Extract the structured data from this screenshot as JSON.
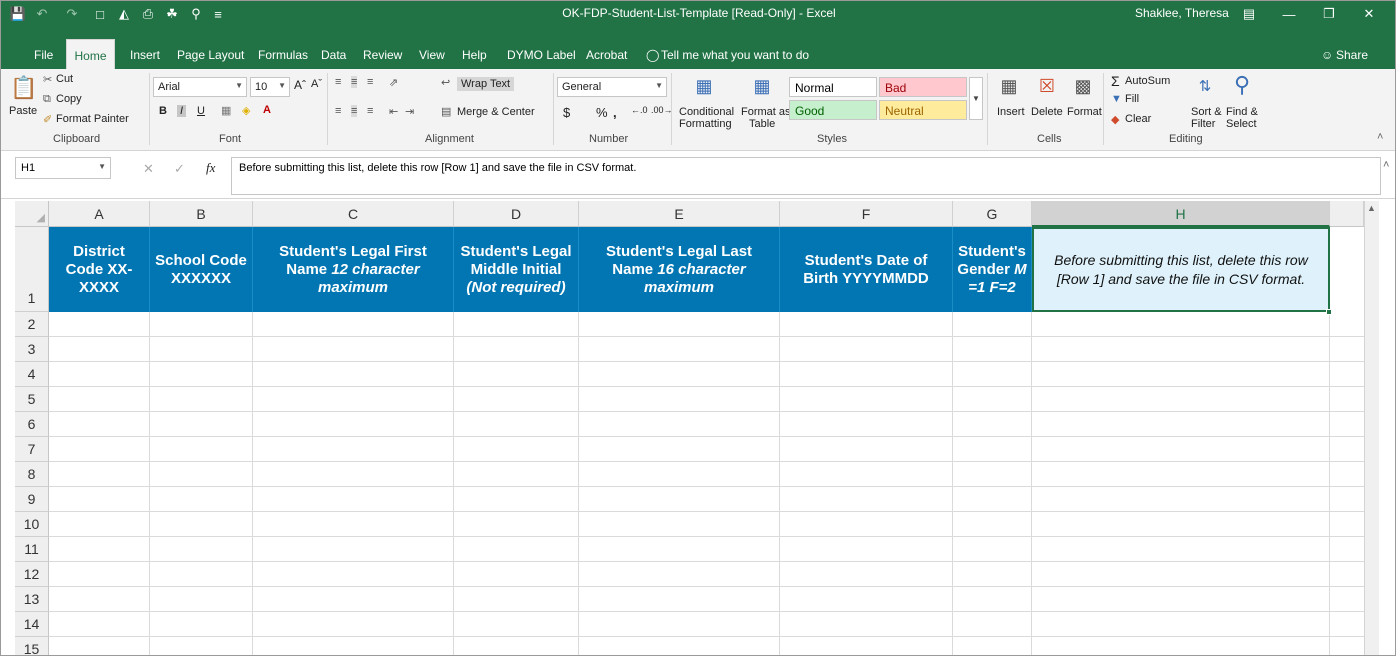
{
  "window": {
    "title": "OK-FDP-Student-List-Template  [Read-Only]  -  Excel",
    "user": "Shaklee, Theresa",
    "share_label": "Share"
  },
  "menu": {
    "tabs": [
      "File",
      "Home",
      "Insert",
      "Page Layout",
      "Formulas",
      "Data",
      "Review",
      "View",
      "Help",
      "DYMO Label",
      "Acrobat"
    ],
    "tell_me": "Tell me what you want to do"
  },
  "ribbon": {
    "clipboard": {
      "label": "Clipboard",
      "paste": "Paste",
      "cut": "Cut",
      "copy": "Copy",
      "format_painter": "Format Painter"
    },
    "font": {
      "label": "Font",
      "name": "Arial",
      "size": "10",
      "bold": "B",
      "italic": "I",
      "underline": "U"
    },
    "alignment": {
      "label": "Alignment",
      "wrap_text": "Wrap Text",
      "merge_center": "Merge & Center"
    },
    "number": {
      "label": "Number",
      "format": "General",
      "currency": "$",
      "percent": "%",
      "comma": ","
    },
    "styles": {
      "label": "Styles",
      "conditional": "Conditional",
      "formatting": "Formatting",
      "format_as": "Format as",
      "table": "Table",
      "cells": {
        "normal": "Normal",
        "bad": "Bad",
        "good": "Good",
        "neutral": "Neutral"
      },
      "colors": {
        "bad_bg": "#ffc7ce",
        "bad_fg": "#9c0006",
        "good_bg": "#c6efce",
        "good_fg": "#006100",
        "neutral_bg": "#ffeb9c",
        "neutral_fg": "#9c6500"
      }
    },
    "cells": {
      "label": "Cells",
      "insert": "Insert",
      "delete": "Delete",
      "format": "Format"
    },
    "editing": {
      "label": "Editing",
      "autosum": "AutoSum",
      "fill": "Fill",
      "clear": "Clear",
      "sort_filter": "Sort &",
      "filter": "Filter",
      "find_select": "Find &",
      "select": "Select"
    }
  },
  "formula_bar": {
    "name_box": "H1",
    "fx": "fx",
    "content": "Before submitting this list, delete this row [Row 1] and save the file in CSV format."
  },
  "sheet": {
    "columns": [
      "A",
      "B",
      "C",
      "D",
      "E",
      "F",
      "G",
      "H"
    ],
    "selected_column": "H",
    "rows": [
      "1",
      "2",
      "3",
      "4",
      "5",
      "6",
      "7",
      "8",
      "9",
      "10",
      "11",
      "12",
      "13",
      "14",
      "15"
    ],
    "header_fill": "#0276b2",
    "headers": {
      "a": "District Code XX-XXXX",
      "b": "School Code XXXXXX",
      "c_main": "Student's Legal First Name",
      "c_ital": "12 character maximum",
      "d_main": "Student's Legal Middle Initial",
      "d_ital": "(Not required)",
      "e_main": "Student's Legal Last Name",
      "e_ital": "16 character maximum",
      "f": "Student's Date of Birth YYYYMMDD",
      "g_main": "Student's Gender",
      "g_ital": "M=1 F=2",
      "h": "Before submitting this list, delete this row [Row 1] and save the file in CSV format."
    }
  }
}
